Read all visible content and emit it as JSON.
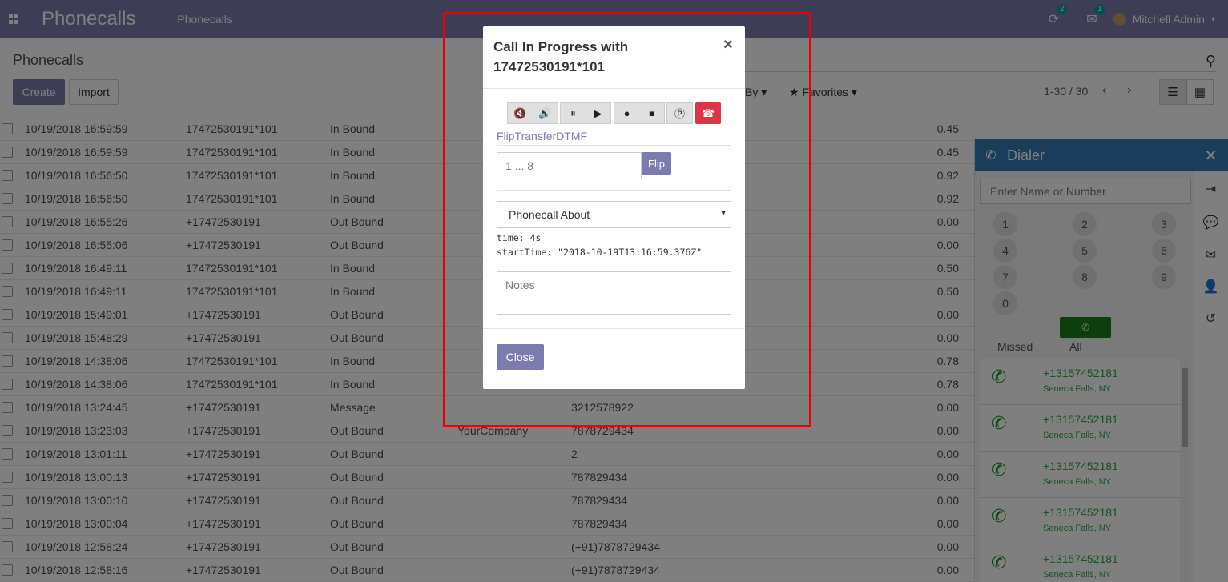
{
  "navbar": {
    "app_title": "Phonecalls",
    "menu_item": "Phonecalls",
    "activity_badge": "2",
    "messages_badge": "1",
    "user_name": "Mitchell Admin"
  },
  "control": {
    "breadcrumb": "Phonecalls",
    "create_label": "Create",
    "import_label": "Import",
    "groupby_label": "By",
    "favorites_label": "Favorites",
    "pager_text": "1-30 / 30"
  },
  "table": {
    "rows": [
      {
        "date": "10/19/2018 16:59:59",
        "number": "17472530191*101",
        "type": "In Bound",
        "partner": "",
        "phone": "",
        "duration": "0.45"
      },
      {
        "date": "10/19/2018 16:59:59",
        "number": "17472530191*101",
        "type": "In Bound",
        "partner": "",
        "phone": "",
        "duration": "0.45"
      },
      {
        "date": "10/19/2018 16:56:50",
        "number": "17472530191*101",
        "type": "In Bound",
        "partner": "",
        "phone": "",
        "duration": "0.92"
      },
      {
        "date": "10/19/2018 16:56:50",
        "number": "17472530191*101",
        "type": "In Bound",
        "partner": "",
        "phone": "",
        "duration": "0.92"
      },
      {
        "date": "10/19/2018 16:55:26",
        "number": "+17472530191",
        "type": "Out Bound",
        "partner": "",
        "phone": "",
        "duration": "0.00"
      },
      {
        "date": "10/19/2018 16:55:06",
        "number": "+17472530191",
        "type": "Out Bound",
        "partner": "",
        "phone": "",
        "duration": "0.00"
      },
      {
        "date": "10/19/2018 16:49:11",
        "number": "17472530191*101",
        "type": "In Bound",
        "partner": "",
        "phone": "",
        "duration": "0.50"
      },
      {
        "date": "10/19/2018 16:49:11",
        "number": "17472530191*101",
        "type": "In Bound",
        "partner": "",
        "phone": "",
        "duration": "0.50"
      },
      {
        "date": "10/19/2018 15:49:01",
        "number": "+17472530191",
        "type": "Out Bound",
        "partner": "",
        "phone": "",
        "duration": "0.00"
      },
      {
        "date": "10/19/2018 15:48:29",
        "number": "+17472530191",
        "type": "Out Bound",
        "partner": "",
        "phone": "",
        "duration": "0.00"
      },
      {
        "date": "10/19/2018 14:38:06",
        "number": "17472530191*101",
        "type": "In Bound",
        "partner": "",
        "phone": "",
        "duration": "0.78"
      },
      {
        "date": "10/19/2018 14:38:06",
        "number": "17472530191*101",
        "type": "In Bound",
        "partner": "",
        "phone": "",
        "duration": "0.78"
      },
      {
        "date": "10/19/2018 13:24:45",
        "number": "+17472530191",
        "type": "Message",
        "partner": "",
        "phone": "3212578922",
        "duration": "0.00"
      },
      {
        "date": "10/19/2018 13:23:03",
        "number": "+17472530191",
        "type": "Out Bound",
        "partner": "YourCompany",
        "phone": "7878729434",
        "duration": "0.00"
      },
      {
        "date": "10/19/2018 13:01:11",
        "number": "+17472530191",
        "type": "Out Bound",
        "partner": "",
        "phone": "2",
        "duration": "0.00"
      },
      {
        "date": "10/19/2018 13:00:13",
        "number": "+17472530191",
        "type": "Out Bound",
        "partner": "",
        "phone": "787829434",
        "duration": "0.00"
      },
      {
        "date": "10/19/2018 13:00:10",
        "number": "+17472530191",
        "type": "Out Bound",
        "partner": "",
        "phone": "787829434",
        "duration": "0.00"
      },
      {
        "date": "10/19/2018 13:00:04",
        "number": "+17472530191",
        "type": "Out Bound",
        "partner": "",
        "phone": "787829434",
        "duration": "0.00"
      },
      {
        "date": "10/19/2018 12:58:24",
        "number": "+17472530191",
        "type": "Out Bound",
        "partner": "",
        "phone": "(+91)7878729434",
        "duration": "0.00"
      },
      {
        "date": "10/19/2018 12:58:16",
        "number": "+17472530191",
        "type": "Out Bound",
        "partner": "",
        "phone": "(+91)7878729434",
        "duration": "0.00"
      }
    ]
  },
  "dialer": {
    "title": "Dialer",
    "input_placeholder": "Enter Name or Number",
    "keys": [
      "1",
      "2",
      "3",
      "4",
      "5",
      "6",
      "7",
      "8",
      "9",
      "0"
    ],
    "tab_missed": "Missed",
    "tab_all": "All",
    "log": [
      {
        "number": "+13157452181",
        "location": "Seneca Falls, NY"
      },
      {
        "number": "+13157452181",
        "location": "Seneca Falls, NY"
      },
      {
        "number": "+13157452181",
        "location": "Seneca Falls, NY"
      },
      {
        "number": "+13157452181",
        "location": "Seneca Falls, NY"
      },
      {
        "number": "+13157452181",
        "location": "Seneca Falls, NY"
      }
    ]
  },
  "modal": {
    "title": "Call In Progress with 17472530191*101",
    "flip_label": "FlipTransferDTMF",
    "flip_placeholder": "1 ... 8",
    "flip_button": "Flip",
    "select_value": "Phonecall About",
    "time_line": "time: 4s",
    "start_line": "startTime: \"2018-10-19T13:16:59.376Z\"",
    "notes_placeholder": "Notes",
    "close_label": "Close"
  },
  "colors": {
    "brand": "#7c7bad",
    "hangup": "#dc3545",
    "dialer_header": "#337ab7",
    "call_green": "#1c7d1c",
    "highlight": "#ee0000"
  }
}
